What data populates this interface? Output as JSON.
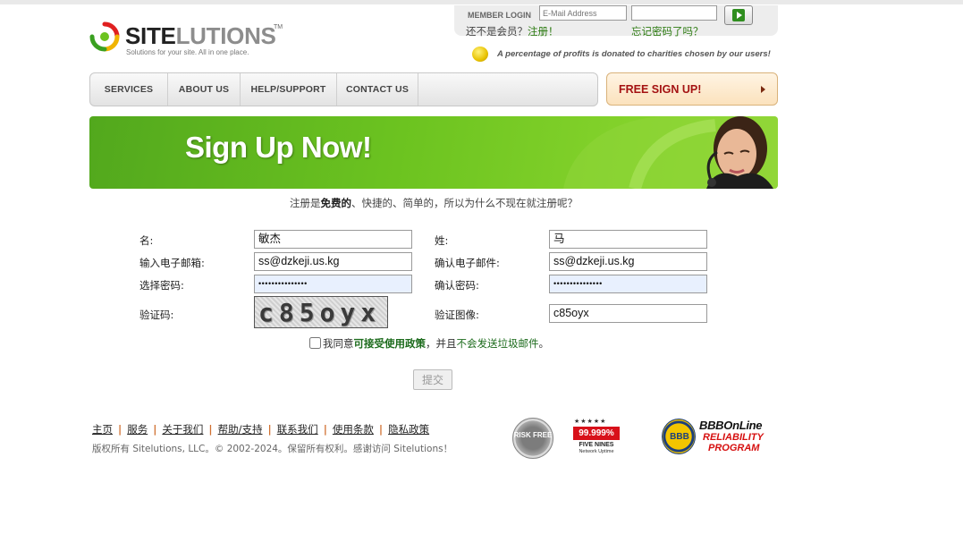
{
  "header": {
    "logo_word_bold": "SITE",
    "logo_word_light": "LUTIONS",
    "logo_tm": "TM",
    "logo_tagline": "Solutions for your site. All in one place.",
    "charity_text": "A percentage of profits is donated to charities chosen by our users!"
  },
  "login": {
    "label": "MEMBER LOGIN",
    "email_placeholder": "E-Mail Address",
    "not_member": "还不是会员？",
    "register_link": "注册！",
    "forgot_link": "忘记密码了吗？"
  },
  "nav": {
    "items": [
      "SERVICES",
      "ABOUT US",
      "HELP/SUPPORT",
      "CONTACT US"
    ],
    "free_signup": "FREE SIGN UP!"
  },
  "banner": {
    "title": "Sign Up Now!"
  },
  "intro": {
    "part1": "注册是",
    "bold": "免费的",
    "part2": "、快捷的、简单的，所以为什么不现在就注册呢？"
  },
  "form": {
    "first_name_label": "名:",
    "first_name_value": "敏杰",
    "last_name_label": "姓:",
    "last_name_value": "马",
    "email_label": "输入电子邮箱:",
    "email_value": "ss@dzkeji.us.kg",
    "confirm_email_label": "确认电子邮件:",
    "confirm_email_value": "ss@dzkeji.us.kg",
    "password_label": "选择密码:",
    "password_value": "•••••••••••••••",
    "confirm_password_label": "确认密码:",
    "confirm_password_value": "•••••••••••••••",
    "captcha_label": "验证码:",
    "captcha_image_text": "c85oyx",
    "captcha_input_label": "验证图像:",
    "captcha_input_value": "c85oyx",
    "agree_prefix": "我同意",
    "agree_policy": "可接受使用政策",
    "agree_mid": "，并且",
    "agree_spam": "不会发送垃圾邮件",
    "agree_end": "。",
    "submit_label": "提交"
  },
  "footer": {
    "links": [
      "主页",
      "服务",
      "关于我们",
      "帮助/支持",
      "联系我们",
      "使用条款",
      "隐私政策"
    ],
    "separator": "|",
    "copyright": "版权所有 Sitelutions, LLC。© 2002-2024。保留所有权利。感谢访问 Sitelutions！"
  },
  "badges": {
    "risk_free": "RISK FREE",
    "nines_stars": "★★★★★",
    "nines_pct": "99.999%",
    "nines_title": "FIVE NINES",
    "nines_sub": "Network Uptime",
    "bbb_seal": "BBB",
    "bbb_line1": "BBBOnLine",
    "bbb_line2": "RELIABILITY",
    "bbb_line3": "PROGRAM"
  },
  "colors": {
    "brand_green": "#6cc320",
    "link_green": "#2b7a10",
    "signup_red": "#a41212"
  }
}
